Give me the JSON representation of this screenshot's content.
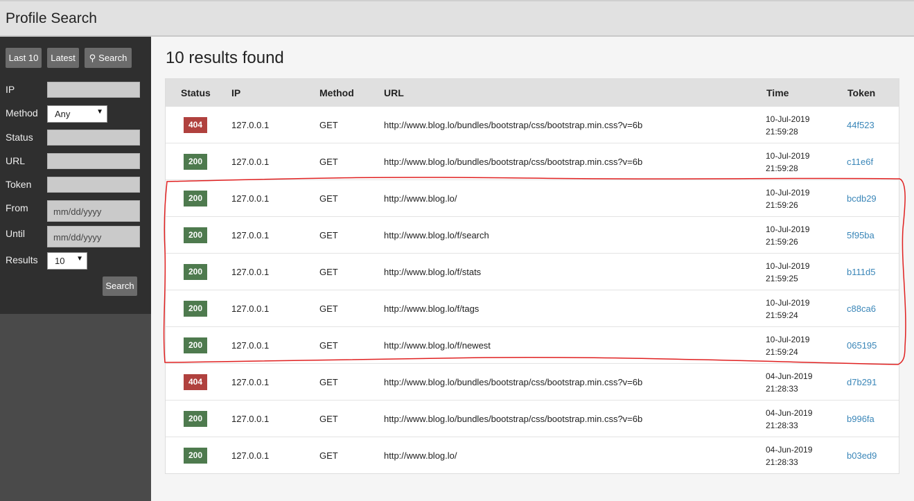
{
  "app": {
    "title": "Profile Search"
  },
  "sidebar": {
    "buttons": {
      "last10": "Last 10",
      "latest": "Latest",
      "search": "Search"
    },
    "form": {
      "ip_label": "IP",
      "ip_value": "",
      "method_label": "Method",
      "method_value": "Any",
      "status_label": "Status",
      "status_value": "",
      "url_label": "URL",
      "url_value": "",
      "token_label": "Token",
      "token_value": "",
      "from_label": "From",
      "from_placeholder": "mm/dd/yyyy",
      "until_label": "Until",
      "until_placeholder": "mm/dd/yyyy",
      "results_label": "Results",
      "results_value": "10",
      "submit_label": "Search"
    }
  },
  "main": {
    "results_title": "10 results found",
    "columns": [
      "Status",
      "IP",
      "Method",
      "URL",
      "Time",
      "Token"
    ],
    "rows": [
      {
        "status": "404",
        "ip": "127.0.0.1",
        "method": "GET",
        "url": "http://www.blog.lo/bundles/bootstrap/css/bootstrap.min.css?v=6b",
        "date": "10-Jul-2019",
        "time": "21:59:28",
        "token": "44f523"
      },
      {
        "status": "200",
        "ip": "127.0.0.1",
        "method": "GET",
        "url": "http://www.blog.lo/bundles/bootstrap/css/bootstrap.min.css?v=6b",
        "date": "10-Jul-2019",
        "time": "21:59:28",
        "token": "c11e6f"
      },
      {
        "status": "200",
        "ip": "127.0.0.1",
        "method": "GET",
        "url": "http://www.blog.lo/",
        "date": "10-Jul-2019",
        "time": "21:59:26",
        "token": "bcdb29"
      },
      {
        "status": "200",
        "ip": "127.0.0.1",
        "method": "GET",
        "url": "http://www.blog.lo/f/search",
        "date": "10-Jul-2019",
        "time": "21:59:26",
        "token": "5f95ba"
      },
      {
        "status": "200",
        "ip": "127.0.0.1",
        "method": "GET",
        "url": "http://www.blog.lo/f/stats",
        "date": "10-Jul-2019",
        "time": "21:59:25",
        "token": "b111d5"
      },
      {
        "status": "200",
        "ip": "127.0.0.1",
        "method": "GET",
        "url": "http://www.blog.lo/f/tags",
        "date": "10-Jul-2019",
        "time": "21:59:24",
        "token": "c88ca6"
      },
      {
        "status": "200",
        "ip": "127.0.0.1",
        "method": "GET",
        "url": "http://www.blog.lo/f/newest",
        "date": "10-Jul-2019",
        "time": "21:59:24",
        "token": "065195"
      },
      {
        "status": "404",
        "ip": "127.0.0.1",
        "method": "GET",
        "url": "http://www.blog.lo/bundles/bootstrap/css/bootstrap.min.css?v=6b",
        "date": "04-Jun-2019",
        "time": "21:28:33",
        "token": "d7b291"
      },
      {
        "status": "200",
        "ip": "127.0.0.1",
        "method": "GET",
        "url": "http://www.blog.lo/bundles/bootstrap/css/bootstrap.min.css?v=6b",
        "date": "04-Jun-2019",
        "time": "21:28:33",
        "token": "b996fa"
      },
      {
        "status": "200",
        "ip": "127.0.0.1",
        "method": "GET",
        "url": "http://www.blog.lo/",
        "date": "04-Jun-2019",
        "time": "21:28:33",
        "token": "b03ed9"
      }
    ]
  },
  "colors": {
    "status_ok": "#4e7a4e",
    "status_error": "#b0413e",
    "token_link": "#3a86b8",
    "annotation": "#e02020"
  }
}
